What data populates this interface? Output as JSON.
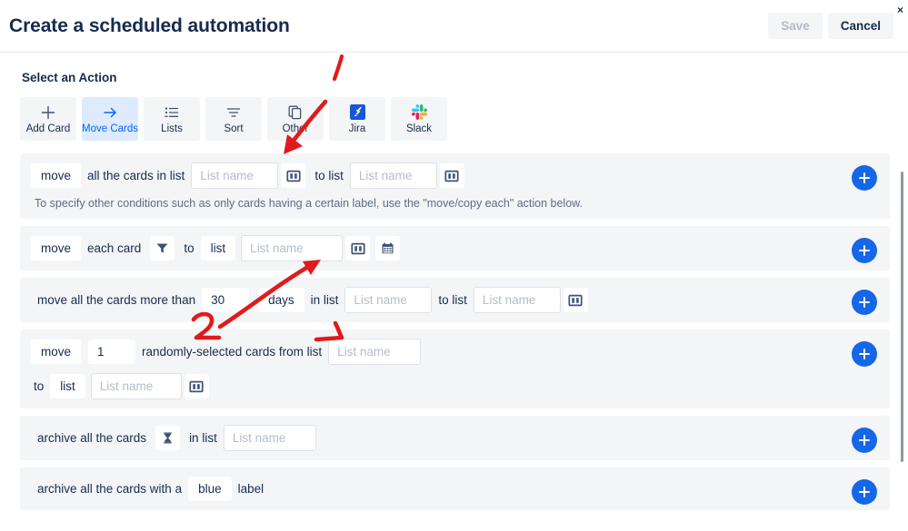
{
  "header": {
    "title": "Create a scheduled automation",
    "save_label": "Save",
    "cancel_label": "Cancel",
    "close_label": "×"
  },
  "section": {
    "title": "Select an Action"
  },
  "tabs": [
    {
      "label": "Add Card",
      "icon": "plus-icon",
      "active": false
    },
    {
      "label": "Move Cards",
      "icon": "arrow-right-icon",
      "active": true
    },
    {
      "label": "Lists",
      "icon": "list-icon",
      "active": false
    },
    {
      "label": "Sort",
      "icon": "sort-icon",
      "active": false
    },
    {
      "label": "Other",
      "icon": "copy-icon",
      "active": false
    },
    {
      "label": "Jira",
      "icon": "jira-icon",
      "active": false
    },
    {
      "label": "Slack",
      "icon": "slack-icon",
      "active": false
    }
  ],
  "rows": {
    "row1": {
      "chip_move": "move",
      "text_all_cards": "all the cards in list",
      "input1_placeholder": "List name",
      "input1_value": "",
      "icon1": "board-icon",
      "text_to_list": "to list",
      "input2_placeholder": "List name",
      "input2_value": "",
      "icon2": "board-icon",
      "hint": "To specify other conditions such as only cards having a certain label, use the \"move/copy each\" action below.",
      "add_label": "+"
    },
    "row2": {
      "chip_move": "move",
      "text_each_card": "each card",
      "icon_filter": "filter-icon",
      "text_to": "to",
      "chip_list": "list",
      "input_placeholder": "List name",
      "input_value": "",
      "icon_board": "board-icon",
      "icon_calendar": "calendar-icon",
      "add_label": "+"
    },
    "row3": {
      "text_prefix": "move all the cards more than",
      "days_value": "30",
      "chip_days": "days",
      "text_in_list": "in list",
      "input1_placeholder": "List name",
      "input1_value": "",
      "text_to_list": "to list",
      "input2_placeholder": "List name",
      "input2_value": "",
      "icon_board": "board-icon",
      "add_label": "+"
    },
    "row4": {
      "chip_move": "move",
      "count_value": "1",
      "text_randomly": "randomly-selected cards from list",
      "input1_placeholder": "List name",
      "input1_value": "",
      "text_to": "to",
      "chip_list": "list",
      "input2_placeholder": "List name",
      "input2_value": "",
      "icon_board": "board-icon",
      "add_label": "+"
    },
    "row5": {
      "text_prefix": "archive all the cards",
      "icon_hourglass": "hourglass-icon",
      "text_in_list": "in list",
      "input_placeholder": "List name",
      "input_value": "",
      "add_label": "+"
    },
    "row6": {
      "text_prefix": "archive all the cards with a",
      "chip_color": "blue",
      "text_suffix": "label",
      "add_label": "+"
    }
  },
  "annotations": {
    "color": "#e01b1b",
    "marks": [
      {
        "name": "stroke-1",
        "note": "red stroke above Jira tab"
      },
      {
        "name": "arrow-1",
        "note": "red arrow pointing down-left to first board icon"
      },
      {
        "name": "arrow-2",
        "note": "red arrow pointing up-right to row2 board icon, with 2 mark"
      },
      {
        "name": "stroke-3",
        "note": "red stroke over row4 randomly-selected text"
      }
    ]
  },
  "colors": {
    "accent_blue": "#0065ff",
    "plus_blue": "#1567e8",
    "tab_active_bg": "#deebff",
    "row_bg": "#f4f5f7",
    "text": "#172b4d",
    "muted": "#5e6c84",
    "placeholder": "#b6bdc9",
    "annotation_red": "#e01b1b"
  }
}
